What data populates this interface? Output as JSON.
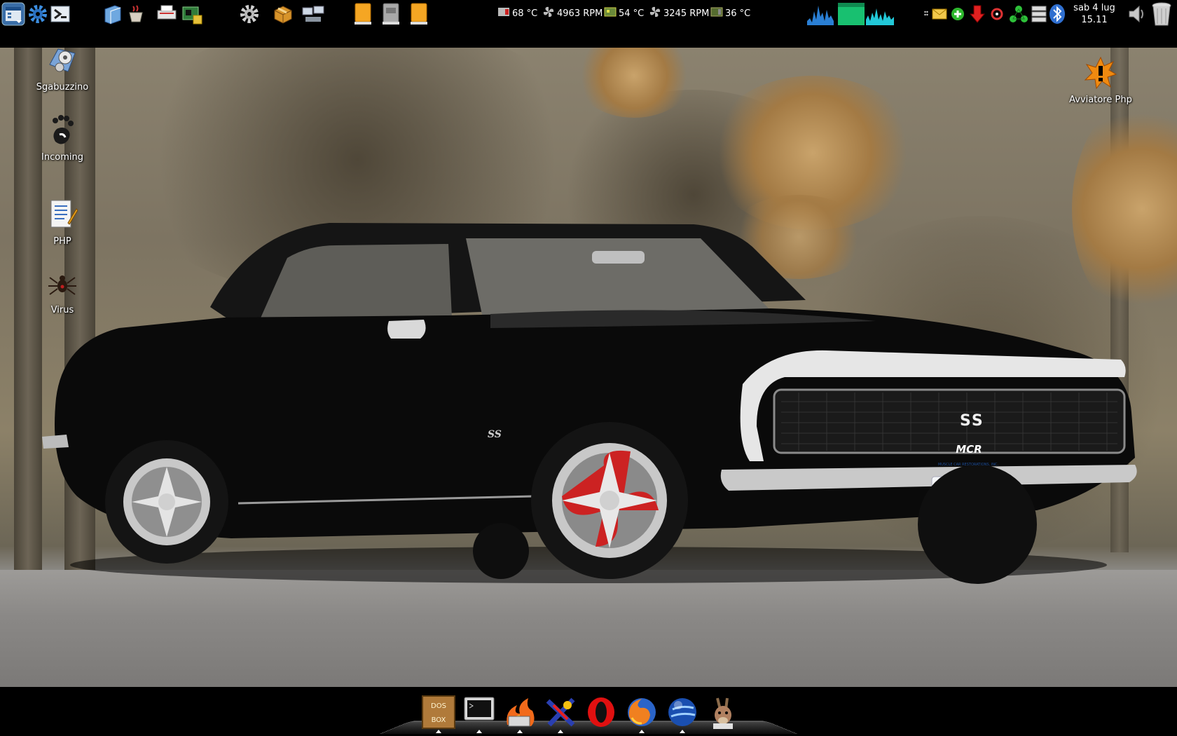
{
  "top_panel": {
    "launchers": [
      {
        "name": "main-menu-icon"
      },
      {
        "name": "settings-gear-icon"
      },
      {
        "name": "logout-arrow-icon"
      },
      {
        "name": "file-manager-icon"
      },
      {
        "name": "coffee-cup-icon"
      },
      {
        "name": "printer-icon"
      },
      {
        "name": "hardware-board-icon"
      },
      {
        "name": "system-settings-gear-icon"
      },
      {
        "name": "package-box-icon"
      },
      {
        "name": "network-computers-icon"
      },
      {
        "name": "drive-orange-icon"
      },
      {
        "name": "drive-gray-icon"
      },
      {
        "name": "drive-orange-2-icon"
      }
    ],
    "sensors": [
      {
        "icon": "cpu-chip-icon",
        "text": "68 °C"
      },
      {
        "icon": "fan-icon",
        "text": "4963 RPM"
      },
      {
        "icon": "board-icon",
        "text": "54 °C"
      },
      {
        "icon": "fan-icon",
        "text": "3245 RPM"
      },
      {
        "icon": "card-icon",
        "text": "36 °C"
      }
    ],
    "monitors": [
      {
        "name": "cpu-graph-icon",
        "color": "#2a7fd4"
      },
      {
        "name": "memory-graph-icon",
        "color": "#18c070"
      },
      {
        "name": "network-graph-icon",
        "color": "#22c8d8"
      }
    ],
    "tray": [
      {
        "name": "handle-dots-icon"
      },
      {
        "name": "mail-icon"
      },
      {
        "name": "add-green-icon"
      },
      {
        "name": "download-red-arrow-icon"
      },
      {
        "name": "recycle-red-icon"
      },
      {
        "name": "share-green-icon"
      },
      {
        "name": "network-status-icon"
      },
      {
        "name": "bluetooth-icon"
      }
    ],
    "clock": {
      "day": "sab  4 lug",
      "time": "15.11"
    },
    "volume_icon": "volume-icon",
    "trash_icon": "trash-icon"
  },
  "desktop": {
    "icons_left": [
      {
        "label": "Sgabuzzino",
        "icon": "folder-film-icon"
      },
      {
        "label": "Incoming",
        "icon": "gnome-foot-icon"
      },
      {
        "label": "PHP",
        "icon": "document-pencil-icon"
      },
      {
        "label": "Virus",
        "icon": "spider-icon"
      }
    ],
    "icons_right": [
      {
        "label": "Avviatore Php",
        "icon": "warning-burst-icon"
      }
    ],
    "wallpaper": {
      "grille_badge": "SS",
      "fender_badge": "SS",
      "plate_text": "MCR",
      "plate_subtext": "MUSCLE CAR RESTORATIONS, INC."
    }
  },
  "dock": {
    "items": [
      {
        "name": "dosbox-icon",
        "label": "DOS BOX"
      },
      {
        "name": "terminal-icon"
      },
      {
        "name": "amarok-fire-icon"
      },
      {
        "name": "xara-icon"
      },
      {
        "name": "opera-icon"
      },
      {
        "name": "firefox-icon"
      },
      {
        "name": "google-earth-icon"
      },
      {
        "name": "amule-donkey-icon"
      }
    ]
  }
}
